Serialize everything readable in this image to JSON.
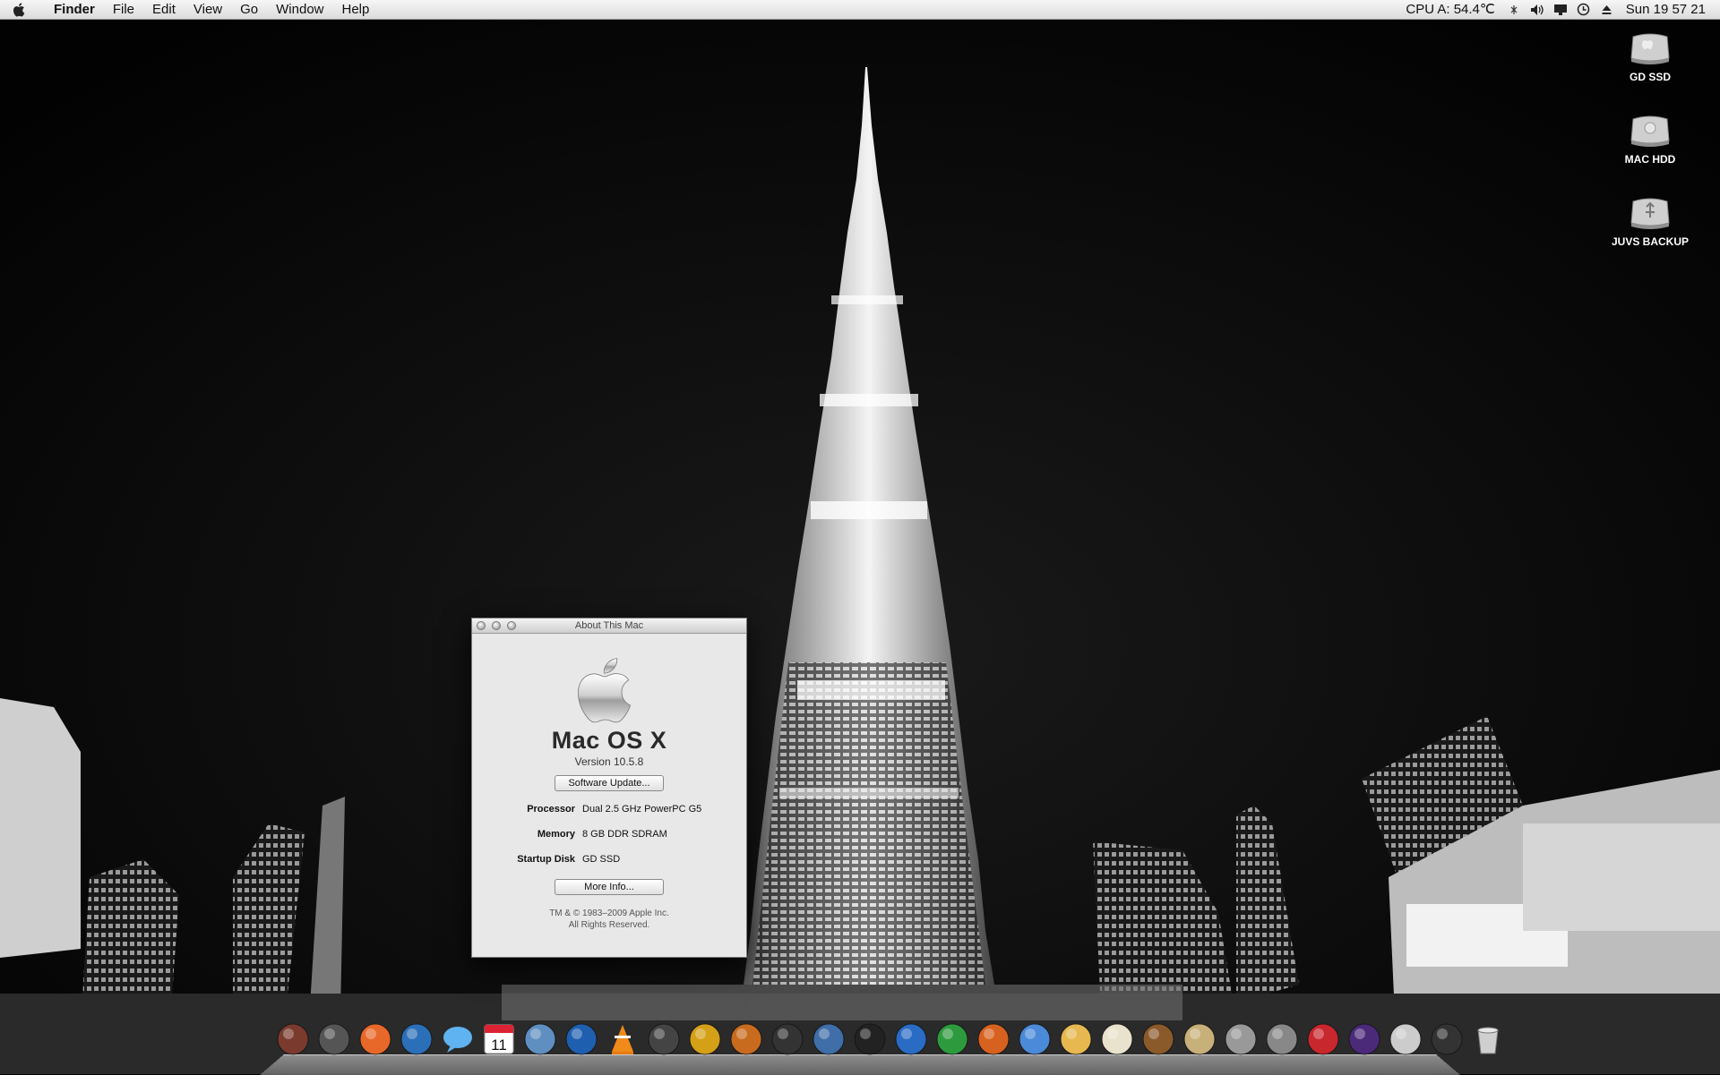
{
  "menubar": {
    "app_name": "Finder",
    "menus": [
      "File",
      "Edit",
      "View",
      "Go",
      "Window",
      "Help"
    ],
    "cpu_status": "CPU A: 54.4℃",
    "clock": "Sun 19 57 21"
  },
  "desktop_icons": [
    {
      "label": "GD SSD",
      "icon": "internal-drive-icon"
    },
    {
      "label": "MAC HDD",
      "icon": "internal-drive-icon"
    },
    {
      "label": "JUVS BACKUP",
      "icon": "usb-drive-icon"
    }
  ],
  "about_window": {
    "title": "About This Mac",
    "os_name": "Mac OS X",
    "version": "Version 10.5.8",
    "software_update_label": "Software Update...",
    "processor_label": "Processor",
    "processor_value": "Dual 2.5 GHz PowerPC G5",
    "memory_label": "Memory",
    "memory_value": "8 GB DDR SDRAM",
    "startup_label": "Startup Disk",
    "startup_value": "GD SSD",
    "more_info_label": "More Info...",
    "copyright_1": "TM & © 1983–2009 Apple Inc.",
    "copyright_2": "All Rights Reserved."
  },
  "calendar_day": "11",
  "colors": {
    "menubar": "#e6e6e6",
    "window_bg": "#e8e8e8",
    "wallpaper": "#050505"
  },
  "dock_icons": [
    "address-book-icon",
    "activity-monitor-icon",
    "firefox-icon",
    "thunderbird-icon",
    "ichat-icon",
    "ical-icon",
    "iphoto-icon",
    "quicktime-icon",
    "vlc-icon",
    "itunes-icon",
    "imovie-icon",
    "garageband-icon",
    "photo-booth-icon",
    "dashboard-icon",
    "script-editor-icon",
    "word-icon",
    "excel-icon",
    "powerpoint-icon",
    "preview-icon",
    "entourage-icon",
    "textedit-icon",
    "keynote-icon",
    "pages-icon",
    "iphoto-library-icon",
    "system-preferences-icon",
    "acrobat-icon",
    "mac-os-x-icon",
    "downloads-stack-icon",
    "ink-icon",
    "trash-icon"
  ]
}
